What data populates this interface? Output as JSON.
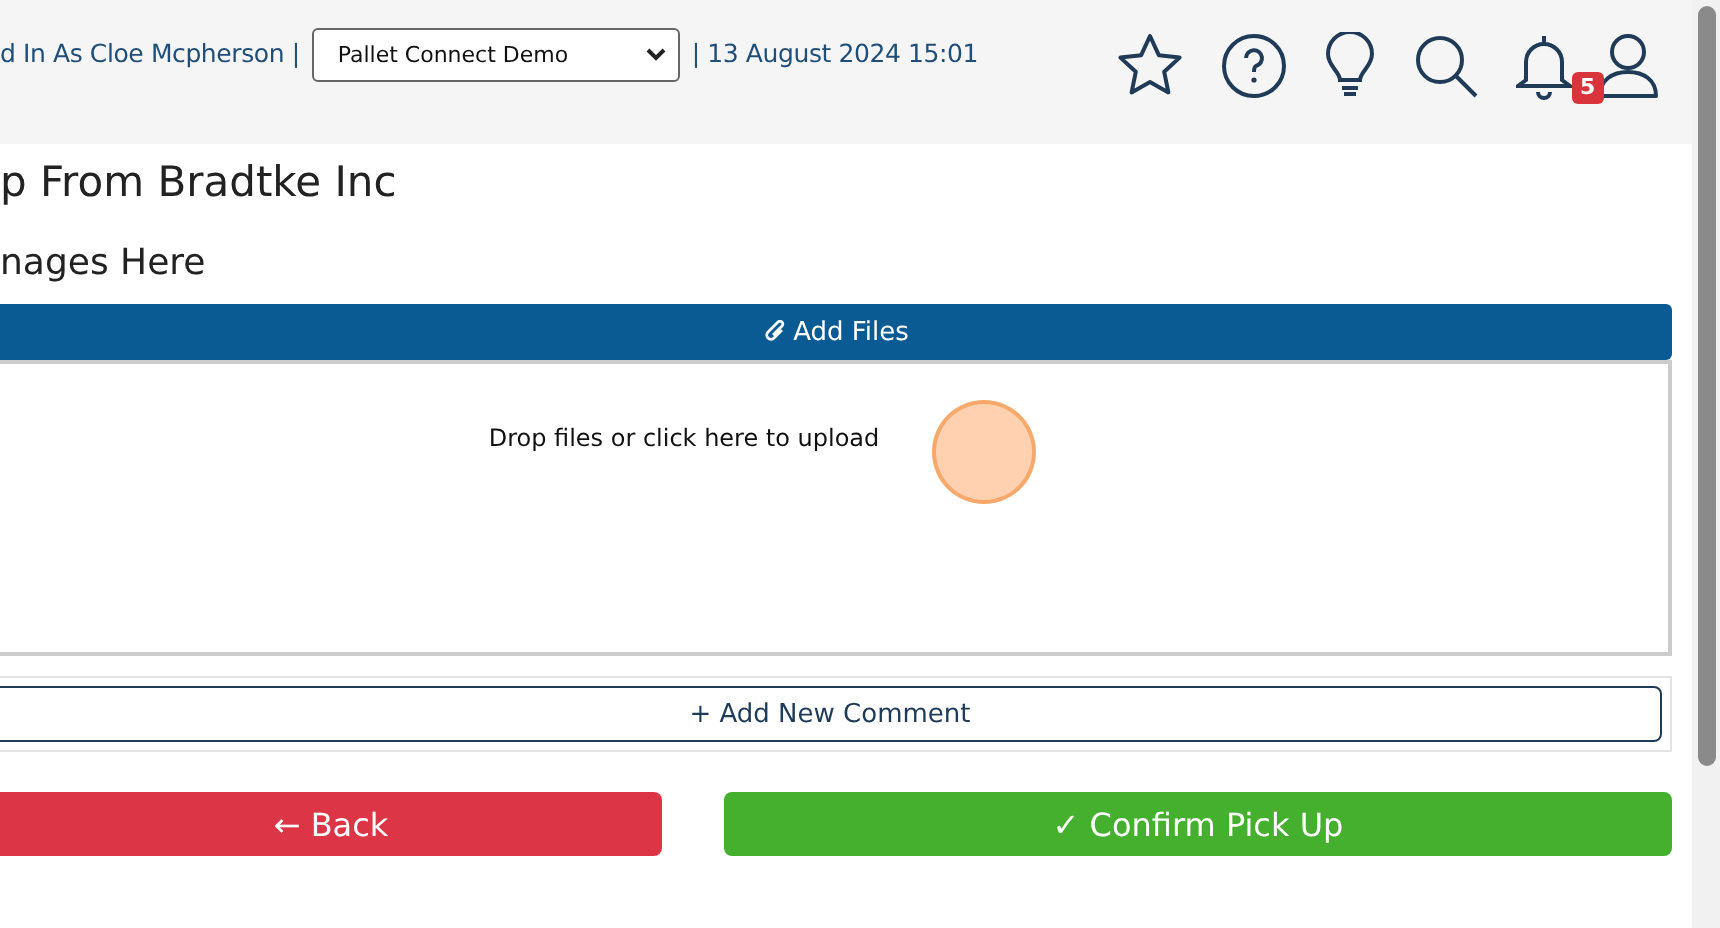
{
  "header": {
    "logged_in_text": "d In As Cloe Mcpherson |",
    "company_select": {
      "value": "Pallet Connect Demo"
    },
    "datetime": "| 13 August 2024 15:01",
    "notification_count": "5"
  },
  "page": {
    "title": "p From Bradtke Inc",
    "subtitle": "nages Here"
  },
  "upload": {
    "button": "Add Files",
    "dropzone_text": "Drop files or click here to upload"
  },
  "comment_button": "+ Add New Comment",
  "actions": [
    {
      "label": "← Back",
      "kind": "danger"
    },
    {
      "label": "✓ Confirm Pick Up",
      "kind": "success"
    }
  ]
}
